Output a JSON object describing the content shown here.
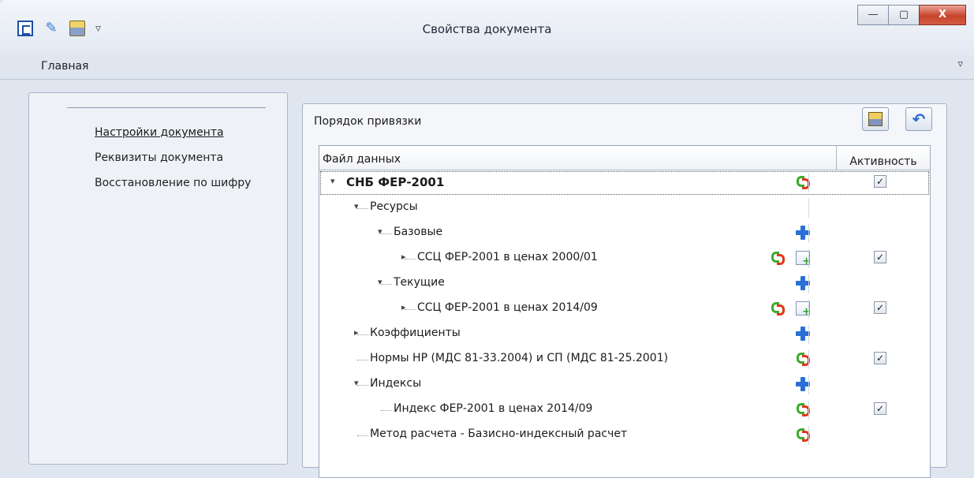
{
  "window": {
    "title": "Свойства документа",
    "buttons": {
      "minimize": "—",
      "maximize": "▢",
      "close": "X"
    }
  },
  "ribbon": {
    "tab": "Главная",
    "collapse_glyph": "▿"
  },
  "qat": {
    "menu_glyph": "▿"
  },
  "sidebar": {
    "items": [
      {
        "label": "Настройки документа",
        "active": true
      },
      {
        "label": "Реквизиты документа",
        "active": false
      },
      {
        "label": "Восстановление по шифру",
        "active": false
      }
    ]
  },
  "group": {
    "title": "Порядок привязки",
    "undo_glyph": "↶",
    "grid": {
      "col_file": "Файл данных",
      "col_active": "Активность",
      "rows": [
        {
          "label": "СНБ ФЕР-2001",
          "level": 0,
          "toggle": "v",
          "bold": true,
          "icons": [
            "refresh-icon"
          ],
          "checked": true
        },
        {
          "label": "Ресурсы",
          "level": 1,
          "toggle": "v",
          "icons": [],
          "checked": null
        },
        {
          "label": "Базовые",
          "level": 2,
          "toggle": "v",
          "icons": [
            "add-icon"
          ],
          "checked": null
        },
        {
          "label": "ССЦ ФЕР-2001 в ценах 2000/01",
          "level": 3,
          "toggle": ">",
          "icons": [
            "refresh-icon",
            "add-document-icon"
          ],
          "checked": true
        },
        {
          "label": "Текущие",
          "level": 2,
          "toggle": "v",
          "icons": [
            "add-icon"
          ],
          "checked": null
        },
        {
          "label": "ССЦ ФЕР-2001 в ценах 2014/09",
          "level": 3,
          "toggle": ">",
          "icons": [
            "refresh-icon",
            "add-document-icon"
          ],
          "checked": true
        },
        {
          "label": "Коэффициенты",
          "level": 1,
          "toggle": ">",
          "icons": [
            "add-icon"
          ],
          "checked": null
        },
        {
          "label": "Нормы НР (МДС 81-33.2004) и СП (МДС 81-25.2001)",
          "level": 1,
          "toggle": "",
          "icons": [
            "refresh-icon"
          ],
          "checked": true
        },
        {
          "label": "Индексы",
          "level": 1,
          "toggle": "v",
          "icons": [
            "add-icon"
          ],
          "checked": null
        },
        {
          "label": "Индекс ФЕР-2001 в ценах 2014/09",
          "level": 2,
          "toggle": "",
          "icons": [
            "refresh-icon"
          ],
          "checked": true
        },
        {
          "label": "Метод расчета - Базисно-индексный расчет",
          "level": 1,
          "toggle": "",
          "icons": [
            "refresh-icon"
          ],
          "checked": null
        }
      ]
    }
  },
  "check_glyph": "✓"
}
